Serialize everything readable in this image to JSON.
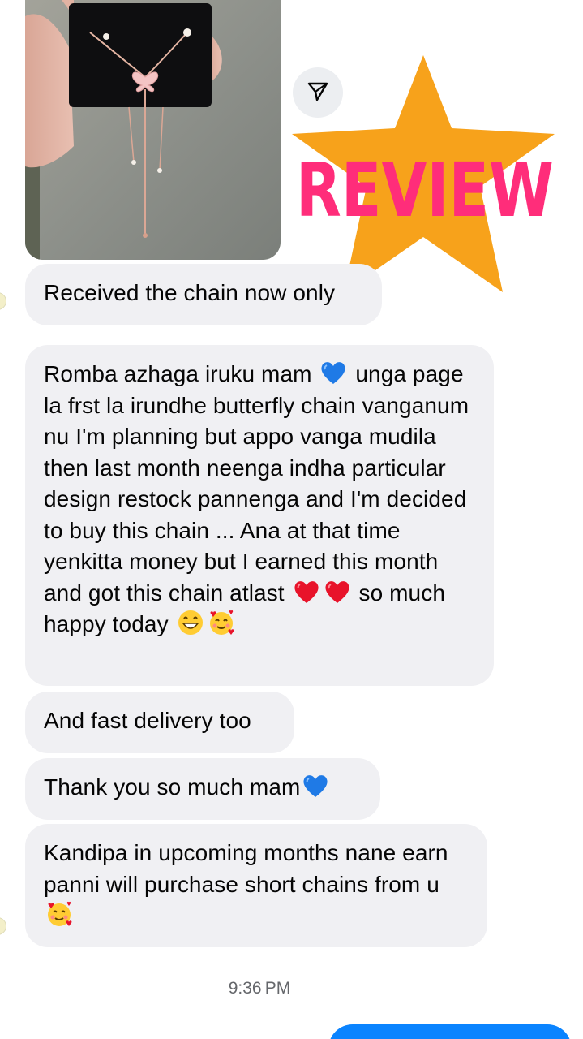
{
  "photo": {
    "alt": "necklace-photo"
  },
  "badge": {
    "text": "REVIEW",
    "star_color": "#f7a21b",
    "text_color": "#ff2d7a"
  },
  "messages": [
    {
      "segments": [
        "Received the chain now only"
      ]
    },
    {
      "segments": [
        "Romba azhaga iruku mam",
        "unga page la frst la irundhe butterfly chain vanganum nu I'm planning but appo vanga mudila then last month neenga indha particular design restock pannenga and I'm decided to buy this chain ... Ana at that time yenkitta money but I earned this month and got this chain atlast",
        "so much happy today"
      ]
    },
    {
      "segments": [
        "And fast delivery too"
      ]
    },
    {
      "segments": [
        "Thank you so much mam"
      ]
    },
    {
      "segments": [
        "Kandipa in upcoming months nane earn panni will purchase short chains from u"
      ]
    }
  ],
  "timestamp": "9:36 PM",
  "colors": {
    "bubble": "#f0f0f3",
    "accent": "#0b84ff",
    "time": "#65676b"
  }
}
